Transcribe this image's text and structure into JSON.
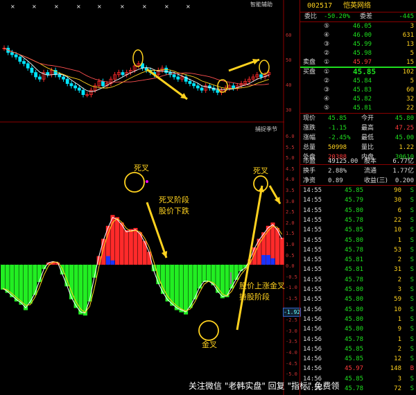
{
  "colors": {
    "up": "#ff2a2a",
    "down": "#22ee22",
    "candle_up": "#00e5ff",
    "accent": "#ffd21f",
    "panel_border": "#8b0000"
  },
  "top_panel": {
    "label": "智能辅助",
    "axis_ticks": [
      "60",
      "50",
      "40",
      "30"
    ]
  },
  "bottom_panel": {
    "label": "捕捉季节",
    "axis_ticks": [
      "6.0",
      "5.5",
      "5.0",
      "4.5",
      "4.0",
      "3.5",
      "3.0",
      "2.5",
      "2.0",
      "1.5",
      "1.0",
      "0.5",
      "0.0",
      "-0.5",
      "-1.0",
      "-1.5",
      "-2.0",
      "-2.5",
      "-3.0",
      "-3.5",
      "-4.0",
      "-4.5",
      "-5.0"
    ],
    "current_value": "-1.92",
    "annotations": {
      "death_cross_1": "死叉",
      "death_phase_1": "死叉阶段",
      "death_phase_2": "股价下跌",
      "gold_cross": "金叉",
      "gold_phase_1": "股价上涨金叉",
      "gold_phase_2": "持股阶段",
      "death_cross_2": "死叉"
    }
  },
  "watermark": "关注微信 \"老韩实盘\" 回复 \"指标\" 免费领",
  "quote": {
    "code": "002517",
    "name": "恺英网络",
    "wei_bi_label": "委比",
    "wei_bi": "-50.20%",
    "wei_cha_label": "委差",
    "wei_cha": "-445",
    "sell_label": "卖盘",
    "buy_label": "买盘",
    "sells": [
      {
        "lvl": "⑤",
        "price": "46.05",
        "vol": "3"
      },
      {
        "lvl": "④",
        "price": "46.00",
        "vol": "631"
      },
      {
        "lvl": "③",
        "price": "45.99",
        "vol": "13"
      },
      {
        "lvl": "②",
        "price": "45.98",
        "vol": "5"
      },
      {
        "lvl": "①",
        "price": "45.97",
        "vol": "15"
      }
    ],
    "buys": [
      {
        "lvl": "①",
        "price": "45.85",
        "vol": "102"
      },
      {
        "lvl": "②",
        "price": "45.84",
        "vol": "5"
      },
      {
        "lvl": "③",
        "price": "45.83",
        "vol": "60"
      },
      {
        "lvl": "④",
        "price": "45.82",
        "vol": "32"
      },
      {
        "lvl": "⑤",
        "price": "45.81",
        "vol": "22"
      }
    ],
    "stats": [
      {
        "l1": "现价",
        "v1": "45.85",
        "c1": "grn",
        "l2": "今开",
        "v2": "45.80",
        "c2": "grn"
      },
      {
        "l1": "涨跌",
        "v1": "-1.15",
        "c1": "grn",
        "l2": "最高",
        "v2": "47.25",
        "c2": "red"
      },
      {
        "l1": "涨幅",
        "v1": "-2.45%",
        "c1": "grn",
        "l2": "最低",
        "v2": "45.00",
        "c2": "grn"
      },
      {
        "l1": "总量",
        "v1": "50998",
        "c1": "yel",
        "l2": "量比",
        "v2": "1.22",
        "c2": "yel"
      },
      {
        "l1": "外盘",
        "v1": "20388",
        "c1": "red",
        "l2": "内盘",
        "v2": "30610",
        "c2": "grn"
      }
    ],
    "finance": [
      {
        "l1": "市盈",
        "v1": "49125.00",
        "l2": "股本",
        "v2": "6.77亿"
      },
      {
        "l1": "换手",
        "v1": "2.88%",
        "l2": "流通",
        "v2": "1.77亿"
      },
      {
        "l1": "净资",
        "v1": "0.89",
        "l2": "收益(三)",
        "v2": "0.200"
      }
    ],
    "ticks": [
      {
        "t": "14:55",
        "p": "45.85",
        "v": "90",
        "d": "S"
      },
      {
        "t": "14:55",
        "p": "45.79",
        "v": "30",
        "d": "S"
      },
      {
        "t": "14:55",
        "p": "45.80",
        "v": "6",
        "d": "S"
      },
      {
        "t": "14:55",
        "p": "45.78",
        "v": "22",
        "d": "S"
      },
      {
        "t": "14:55",
        "p": "45.85",
        "v": "10",
        "d": "S"
      },
      {
        "t": "14:55",
        "p": "45.80",
        "v": "1",
        "d": "S"
      },
      {
        "t": "14:55",
        "p": "45.78",
        "v": "53",
        "d": "S"
      },
      {
        "t": "14:55",
        "p": "45.81",
        "v": "2",
        "d": "S"
      },
      {
        "t": "14:55",
        "p": "45.81",
        "v": "31",
        "d": "S"
      },
      {
        "t": "14:55",
        "p": "45.78",
        "v": "2",
        "d": "S"
      },
      {
        "t": "14:55",
        "p": "45.80",
        "v": "3",
        "d": "S"
      },
      {
        "t": "14:55",
        "p": "45.80",
        "v": "59",
        "d": "S"
      },
      {
        "t": "14:56",
        "p": "45.80",
        "v": "10",
        "d": "S"
      },
      {
        "t": "14:56",
        "p": "45.80",
        "v": "1",
        "d": "S"
      },
      {
        "t": "14:56",
        "p": "45.80",
        "v": "9",
        "d": "S"
      },
      {
        "t": "14:56",
        "p": "45.78",
        "v": "1",
        "d": "S"
      },
      {
        "t": "14:56",
        "p": "45.85",
        "v": "2",
        "d": "S"
      },
      {
        "t": "14:56",
        "p": "45.85",
        "v": "12",
        "d": "S"
      },
      {
        "t": "14:56",
        "p": "45.97",
        "v": "148",
        "d": "B"
      },
      {
        "t": "14:56",
        "p": "45.85",
        "v": "3",
        "d": "S"
      },
      {
        "t": "14:56",
        "p": "45.78",
        "v": "72",
        "d": "S"
      }
    ]
  }
}
